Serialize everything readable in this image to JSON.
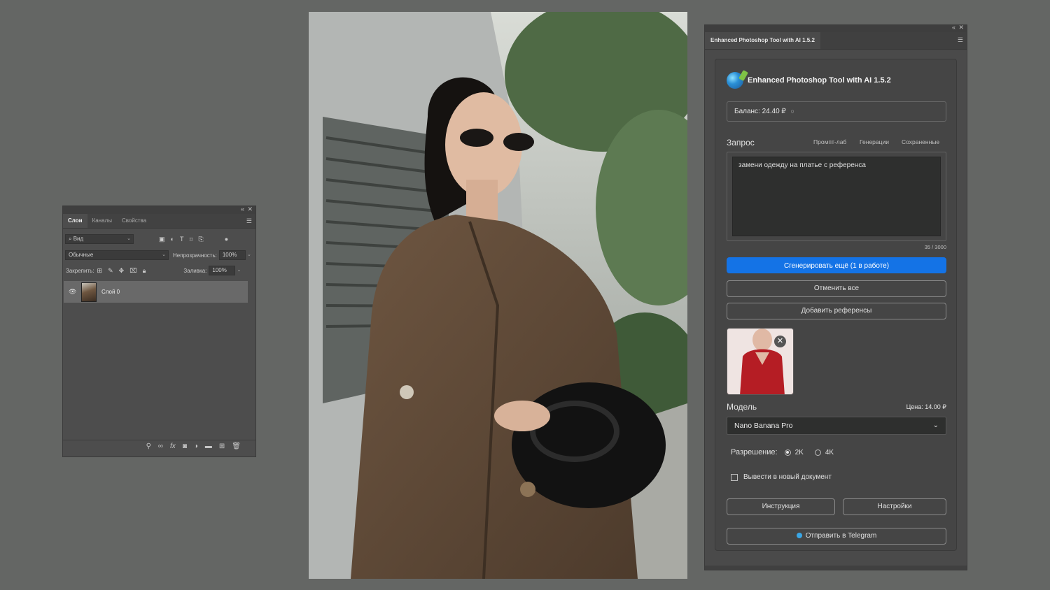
{
  "layers_panel": {
    "tabs": [
      "Слои",
      "Каналы",
      "Свойства"
    ],
    "filter_label": "Вид",
    "blend_mode": "Обычные",
    "opacity_label": "Непрозрачность:",
    "opacity_value": "100%",
    "lock_label": "Закрепить:",
    "fill_label": "Заливка:",
    "fill_value": "100%",
    "layers": [
      {
        "name": "Слой 0"
      }
    ],
    "icons": {
      "filter_kinds": [
        "image-filter-icon",
        "adjustment-filter-icon",
        "type-filter-icon",
        "shape-filter-icon",
        "smart-object-filter-icon"
      ],
      "locks": [
        "lock-transparent-icon",
        "lock-brush-icon",
        "lock-move-icon",
        "lock-artboard-icon",
        "lock-all-icon"
      ],
      "bottom": [
        "link-layers-icon",
        "chain-icon",
        "fx-icon",
        "mask-icon",
        "adjustment-layer-icon",
        "folder-icon",
        "new-layer-icon",
        "trash-icon"
      ]
    }
  },
  "plugin": {
    "tab_title": "Enhanced Photoshop Tool with AI 1.5.2",
    "title": "Enhanced Photoshop Tool with AI 1.5.2",
    "balance": "Баланс: 24.40 ₽",
    "prompt_label": "Запрос",
    "sub_tabs": [
      "Промпт-лаб",
      "Генерации",
      "Сохраненные"
    ],
    "prompt_text": "замени одежду на платье с референса",
    "counter": "35 / 3000",
    "generate_button": "Сгенерировать ещё (1 в работе)",
    "cancel_all_button": "Отменить все",
    "add_refs_button": "Добавить референсы",
    "model_label": "Модель",
    "price": "Цена: 14.00 ₽",
    "model_value": "Nano Banana Pro",
    "resolution_label": "Разрешение:",
    "resolution_options": [
      "2K",
      "4K"
    ],
    "resolution_selected": "2K",
    "new_doc_label": "Вывести в новый документ",
    "new_doc_checked": false,
    "instructions_button": "Инструкция",
    "settings_button": "Настройки",
    "telegram_button": "Отправить в Telegram",
    "accent_color": "#1473e6"
  }
}
